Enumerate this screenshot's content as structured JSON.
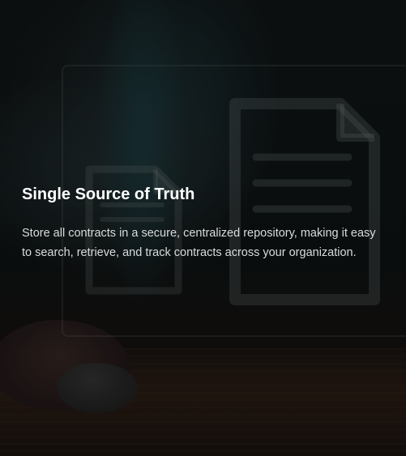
{
  "feature": {
    "title": "Single Source of Truth",
    "description": "Store all contracts in a secure, centralized repository, making it easy to search, retrieve, and track contracts across your organization."
  },
  "background": {
    "icons": [
      "document-icon",
      "document-icon"
    ],
    "colors": {
      "overlay_stroke": "#5f6868",
      "title_text": "#ffffff",
      "body_text": "#d9dcdc"
    }
  }
}
